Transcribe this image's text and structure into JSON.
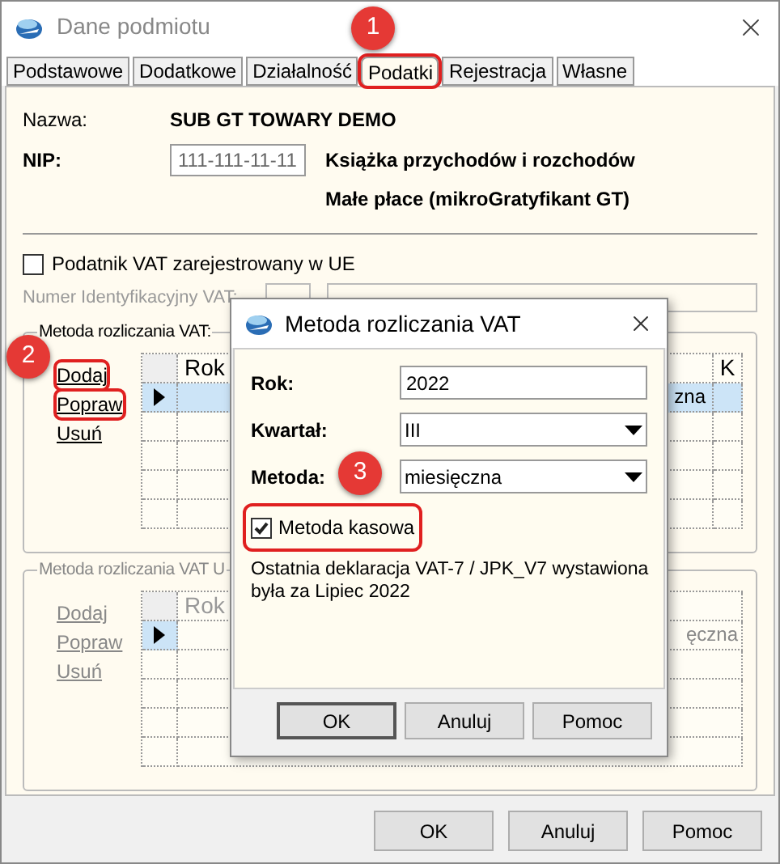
{
  "window": {
    "title": "Dane podmiotu"
  },
  "tabs": [
    {
      "label": "Podstawowe",
      "selected": false,
      "highlighted": false
    },
    {
      "label": "Dodatkowe",
      "selected": false,
      "highlighted": false
    },
    {
      "label": "Działalność",
      "selected": false,
      "highlighted": false
    },
    {
      "label": "Podatki",
      "selected": true,
      "highlighted": true
    },
    {
      "label": "Rejestracja",
      "selected": false,
      "highlighted": false
    },
    {
      "label": "Własne",
      "selected": false,
      "highlighted": false
    }
  ],
  "company": {
    "name_label": "Nazwa:",
    "name": "SUB GT TOWARY DEMO",
    "nip_label": "NIP:",
    "nip": "111-111-11-11",
    "lines": [
      "Książka przychodów i rozchodów",
      "Małe płace (mikroGratyfikant GT)"
    ]
  },
  "eu_vat": {
    "label": "Podatnik VAT zarejestrowany w UE",
    "checked": false,
    "id_label": "Numer Identyfikacyjny VAT:",
    "disabled": true
  },
  "groups": [
    {
      "legend": "Metoda rozliczania VAT:",
      "disabled": false,
      "links": [
        {
          "label": "Dodaj",
          "highlighted": true
        },
        {
          "label": "Popraw",
          "highlighted": true
        },
        {
          "label": "Usuń",
          "highlighted": false
        }
      ],
      "header_left": "Rok",
      "header_right": "K",
      "row_text": "zna",
      "rows": [
        {
          "selected": true
        },
        {
          "selected": false
        },
        {
          "selected": false
        },
        {
          "selected": false
        },
        {
          "selected": false
        }
      ]
    },
    {
      "legend": "Metoda rozliczania VAT U",
      "disabled": true,
      "links": [
        {
          "label": "Dodaj",
          "highlighted": false
        },
        {
          "label": "Popraw",
          "highlighted": false
        },
        {
          "label": "Usuń",
          "highlighted": false
        }
      ],
      "header_left": "Rok",
      "row_text": "ęczna",
      "rows": [
        {
          "selected": true
        },
        {
          "selected": false
        },
        {
          "selected": false
        },
        {
          "selected": false
        },
        {
          "selected": false
        }
      ]
    }
  ],
  "buttons": [
    "OK",
    "Anuluj",
    "Pomoc"
  ],
  "dialog": {
    "title": "Metoda rozliczania VAT",
    "fields": [
      {
        "label": "Rok:",
        "value": "2022",
        "kind": "text"
      },
      {
        "label": "Kwartał:",
        "value": "III",
        "kind": "select"
      },
      {
        "label": "Metoda:",
        "value": "miesięczna",
        "kind": "select"
      }
    ],
    "checkbox": {
      "label": "Metoda kasowa",
      "checked": true,
      "highlighted": true
    },
    "note": "Ostatnia deklaracja VAT-7 / JPK_V7 wystawiona była za Lipiec 2022",
    "buttons": [
      {
        "label": "OK",
        "default": true
      },
      {
        "label": "Anuluj",
        "default": false
      },
      {
        "label": "Pomoc",
        "default": false
      }
    ]
  },
  "callouts": [
    "1",
    "2",
    "3"
  ]
}
